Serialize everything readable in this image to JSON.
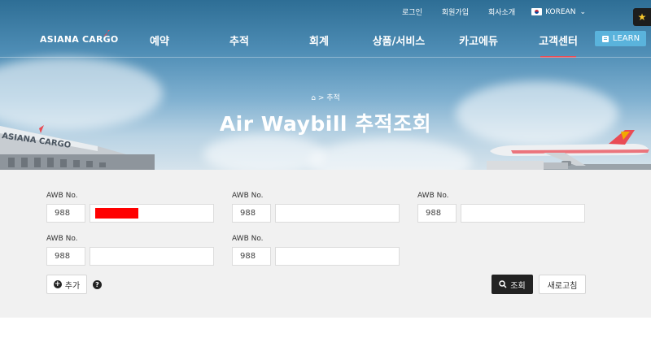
{
  "topbar": {
    "links": [
      "로그인",
      "회원가입",
      "회사소개"
    ],
    "language": "KOREAN"
  },
  "logo": {
    "text": "ASIANA CARGO"
  },
  "nav": {
    "items": [
      "예약",
      "추적",
      "회계",
      "상품/서비스",
      "카고에듀",
      "고객센터"
    ],
    "learn_label": "LEARN"
  },
  "hero": {
    "breadcrumb": "> 추적",
    "title": "Air Waybill 추적조회"
  },
  "form": {
    "awb_label": "AWB No.",
    "rows": [
      [
        {
          "prefix": "988",
          "number": ""
        },
        {
          "prefix": "988",
          "number": ""
        },
        {
          "prefix": "988",
          "number": ""
        }
      ],
      [
        {
          "prefix": "988",
          "number": ""
        },
        {
          "prefix": "988",
          "number": ""
        }
      ]
    ],
    "add_label": "추가",
    "search_label": "조회",
    "reset_label": "새로고침"
  },
  "colors": {
    "accent_red": "#e94b54",
    "learn_blue": "#5ab3dc",
    "form_bg": "#f1f1f1"
  }
}
